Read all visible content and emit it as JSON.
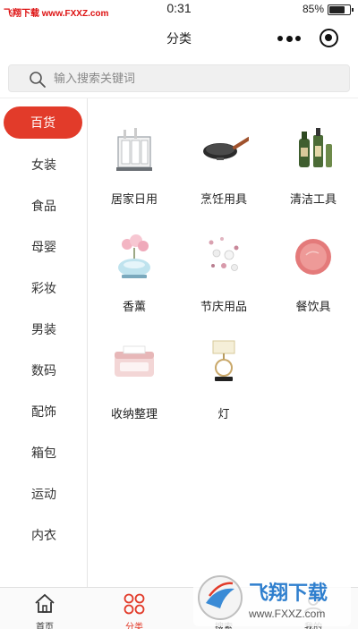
{
  "status_bar": {
    "watermark": "飞翔下载 www.FXXZ.com",
    "time": "0:31",
    "battery_percent": "85%",
    "battery_level": 0.85
  },
  "nav": {
    "title": "分类"
  },
  "search": {
    "placeholder": "输入搜索关键词"
  },
  "sidebar": {
    "items": [
      {
        "label": "百货",
        "active": true
      },
      {
        "label": "女装"
      },
      {
        "label": "食品"
      },
      {
        "label": "母婴"
      },
      {
        "label": "彩妆"
      },
      {
        "label": "男装"
      },
      {
        "label": "数码"
      },
      {
        "label": "配饰"
      },
      {
        "label": "箱包"
      },
      {
        "label": "运动"
      },
      {
        "label": "内衣"
      }
    ]
  },
  "grid": {
    "items": [
      {
        "label": "居家日用",
        "icon": "storage-box-icon"
      },
      {
        "label": "烹饪用具",
        "icon": "frying-pan-icon"
      },
      {
        "label": "清洁工具",
        "icon": "cleaning-bottles-icon"
      },
      {
        "label": "香薰",
        "icon": "aroma-diffuser-icon"
      },
      {
        "label": "节庆用品",
        "icon": "festive-decor-icon"
      },
      {
        "label": "餐饮具",
        "icon": "plate-icon"
      },
      {
        "label": "收纳整理",
        "icon": "organizer-box-icon"
      },
      {
        "label": "灯",
        "icon": "lamp-icon"
      }
    ]
  },
  "tabbar": {
    "items": [
      {
        "label": "首页",
        "icon": "home-icon"
      },
      {
        "label": "分类",
        "icon": "category-icon",
        "active": true
      },
      {
        "label": "搜索",
        "icon": "search-icon"
      },
      {
        "label": "我的",
        "icon": "user-icon"
      }
    ]
  },
  "watermark_logo": {
    "title": "飞翔下载",
    "url": "www.FXXZ.com"
  },
  "colors": {
    "accent": "#e23b2a"
  }
}
